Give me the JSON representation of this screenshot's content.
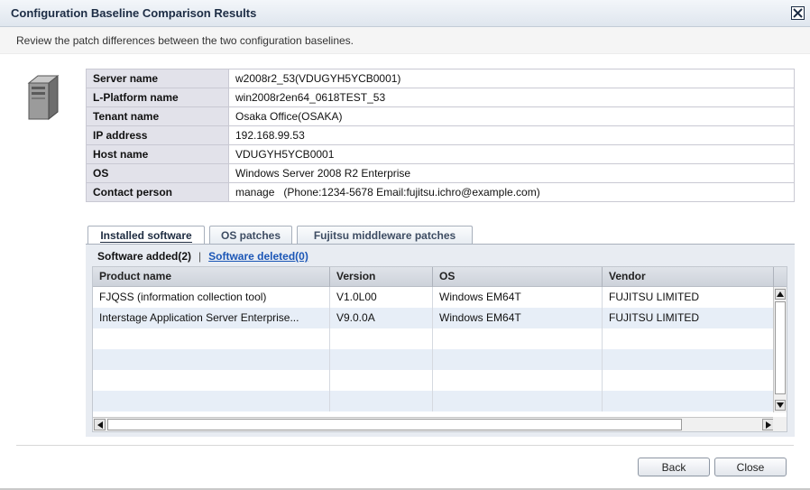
{
  "window": {
    "title": "Configuration Baseline Comparison Results",
    "subtitle": "Review the patch differences between the two configuration baselines."
  },
  "server_info": [
    {
      "label": "Server name",
      "value": "w2008r2_53(VDUGYH5YCB0001)"
    },
    {
      "label": "L-Platform name",
      "value": "win2008r2en64_0618TEST_53"
    },
    {
      "label": "Tenant name",
      "value": "Osaka Office(OSAKA)"
    },
    {
      "label": "IP address",
      "value": "192.168.99.53"
    },
    {
      "label": "Host name",
      "value": "VDUGYH5YCB0001"
    },
    {
      "label": "OS",
      "value": "Windows Server 2008 R2 Enterprise"
    },
    {
      "label": "Contact person",
      "value": "manage   (Phone:1234-5678 Email:fujitsu.ichro@example.com)"
    }
  ],
  "tabs": [
    {
      "label": "Installed software",
      "active": true
    },
    {
      "label": "OS patches",
      "active": false
    },
    {
      "label": "Fujitsu middleware patches",
      "active": false
    }
  ],
  "subtabs": {
    "added": "Software added(2)",
    "separator": "|",
    "deleted": "Software deleted(0)"
  },
  "grid": {
    "columns": [
      "Product name",
      "Version",
      "OS",
      "Vendor"
    ],
    "rows": [
      [
        "FJQSS (information collection tool)",
        "V1.0L00",
        "Windows EM64T",
        "FUJITSU LIMITED"
      ],
      [
        "Interstage Application Server Enterprise...",
        "V9.0.0A",
        "Windows EM64T",
        "FUJITSU LIMITED"
      ]
    ]
  },
  "buttons": {
    "back": "Back",
    "close": "Close"
  },
  "icons": {
    "window_close": "close-icon",
    "server": "server-icon"
  }
}
